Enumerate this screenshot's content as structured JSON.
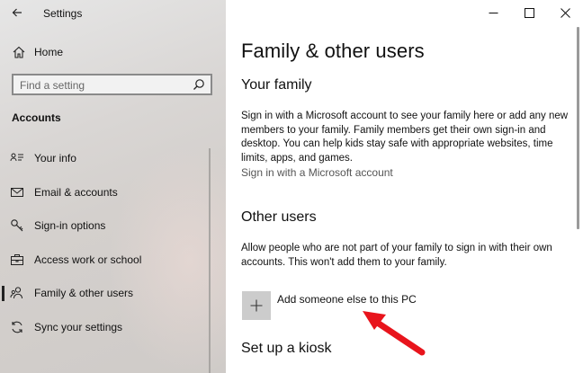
{
  "window": {
    "title": "Settings",
    "controls": {
      "minimize": "—",
      "maximize": "☐",
      "close": "✕"
    }
  },
  "sidebar": {
    "home_label": "Home",
    "search_placeholder": "Find a setting",
    "section_title": "Accounts",
    "items": [
      {
        "label": "Your info",
        "icon": "person-card-icon"
      },
      {
        "label": "Email & accounts",
        "icon": "mail-icon"
      },
      {
        "label": "Sign-in options",
        "icon": "key-icon"
      },
      {
        "label": "Access work or school",
        "icon": "briefcase-icon"
      },
      {
        "label": "Family & other users",
        "icon": "people-icon",
        "selected": true
      },
      {
        "label": "Sync your settings",
        "icon": "sync-icon"
      }
    ]
  },
  "main": {
    "title": "Family & other users",
    "your_family": {
      "heading": "Your family",
      "description": "Sign in with a Microsoft account to see your family here or add any new members to your family. Family members get their own sign-in and desktop. You can help kids stay safe with appropriate websites, time limits, apps, and games.",
      "link": "Sign in with a Microsoft account"
    },
    "other_users": {
      "heading": "Other users",
      "description": "Allow people who are not part of your family to sign in with their own accounts. This won't add them to your family.",
      "add_label": "Add someone else to this PC"
    },
    "kiosk": {
      "heading": "Set up a kiosk"
    }
  },
  "colors": {
    "accent_arrow": "#e8141c",
    "add_tile": "#cccccc"
  }
}
